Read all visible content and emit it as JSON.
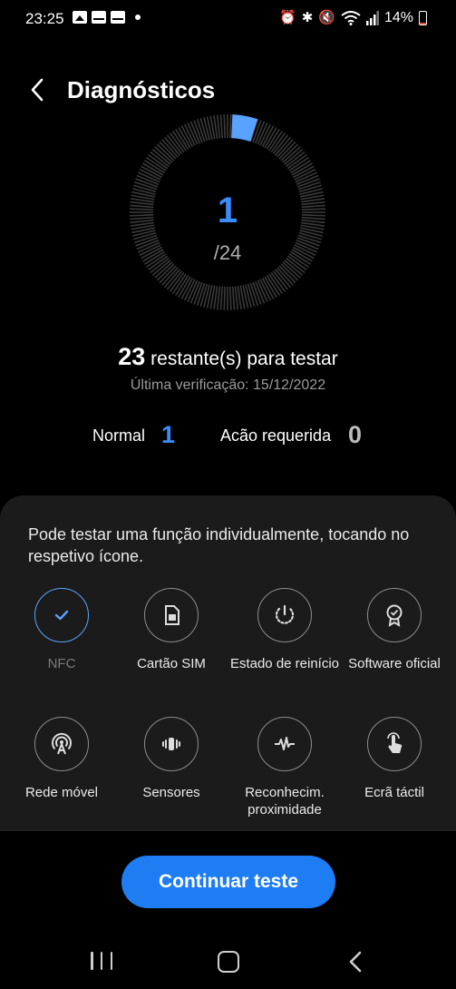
{
  "status_bar": {
    "time": "23:25",
    "battery": "14%",
    "left_icons": [
      "image-icon",
      "mail-icon",
      "mail-icon",
      "dot"
    ],
    "right_icons": [
      "alarm-icon",
      "bluetooth-icon",
      "mute-icon",
      "wifi-icon",
      "signal-icon",
      "battery-icon"
    ]
  },
  "header": {
    "title": "Diagnósticos",
    "back_icon": "chevron-left-icon"
  },
  "progress": {
    "tested": "1",
    "total": "/24",
    "tested_fraction": 0.0417,
    "accent_color": "#3a8dff"
  },
  "summary": {
    "remaining_count": "23",
    "remaining_text": "restante(s) para testar",
    "last_check": "Última verificação: 15/12/2022"
  },
  "stats": {
    "normal_label": "Normal",
    "normal_value": "1",
    "action_label": "Acão requerida",
    "action_value": "0"
  },
  "panel": {
    "hint": "Pode testar uma função individualmente, tocando no respetivo ícone.",
    "tests": [
      {
        "label": "NFC",
        "icon": "check-icon",
        "state": "done"
      },
      {
        "label": "Cartão SIM",
        "icon": "sim-card-icon",
        "state": "pending"
      },
      {
        "label": "Estado de reinício",
        "icon": "restart-icon",
        "state": "pending"
      },
      {
        "label": "Software oficial",
        "icon": "badge-icon",
        "state": "pending"
      },
      {
        "label": "Rede móvel",
        "icon": "antenna-icon",
        "state": "pending"
      },
      {
        "label": "Sensores",
        "icon": "vibration-icon",
        "state": "pending"
      },
      {
        "label": "Reconhecim. proximidade",
        "icon": "waveform-icon",
        "state": "pending"
      },
      {
        "label": "Ecrã táctil",
        "icon": "touch-icon",
        "state": "pending"
      }
    ]
  },
  "actions": {
    "continue_label": "Continuar teste",
    "button_color": "#1e7df3"
  },
  "nav": {
    "recent_icon": "recent-apps-icon",
    "home_icon": "home-icon",
    "back_icon": "back-icon"
  }
}
